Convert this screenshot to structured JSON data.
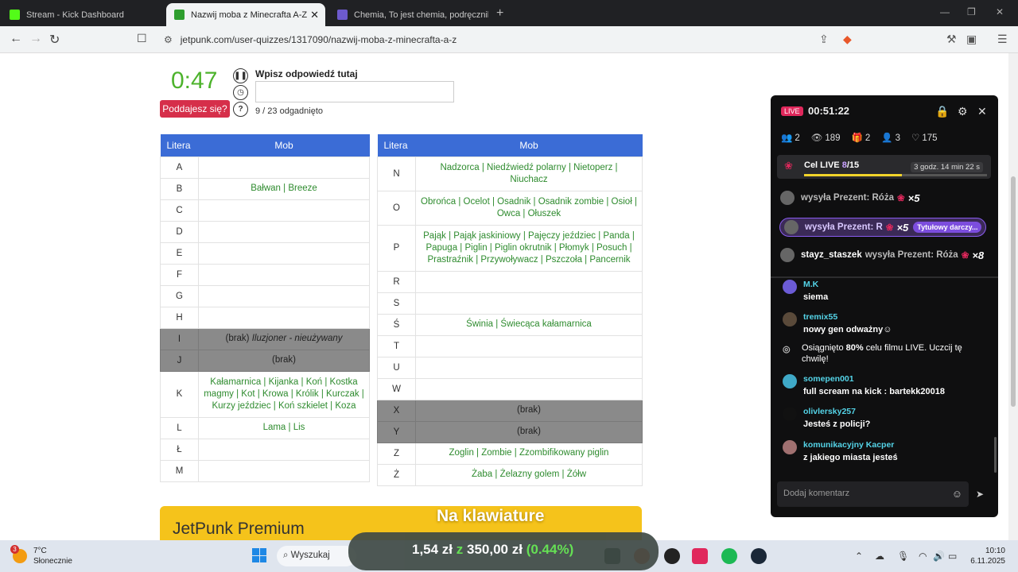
{
  "browser": {
    "tabs": [
      {
        "label": "Stream - Kick Dashboard",
        "active": false
      },
      {
        "label": "Nazwij moba z Minecrafta A-Z",
        "active": true
      },
      {
        "label": "Chemia, To jest chemia, podręcznik, l",
        "active": false
      }
    ],
    "url": "jetpunk.com/user-quizzes/1317090/nazwij-moba-z-minecrafta-a-z"
  },
  "quiz": {
    "timer": "0:47",
    "give_up": "Poddajesz się?",
    "answer_label": "Wpisz odpowiedź tutaj",
    "answer_value": "",
    "progress": "9 / 23 odgadnięto",
    "col_letter": "Litera",
    "col_mob": "Mob",
    "left_rows": [
      {
        "l": "A",
        "m": ""
      },
      {
        "l": "B",
        "m": "Bałwan | Breeze"
      },
      {
        "l": "C",
        "m": ""
      },
      {
        "l": "D",
        "m": ""
      },
      {
        "l": "E",
        "m": ""
      },
      {
        "l": "F",
        "m": ""
      },
      {
        "l": "G",
        "m": ""
      },
      {
        "l": "H",
        "m": ""
      },
      {
        "l": "I",
        "m": "(brak) Iluzjoner - nieużywany",
        "gray": true
      },
      {
        "l": "J",
        "m": "(brak)",
        "gray": true
      },
      {
        "l": "K",
        "m": "Kałamarnica | Kijanka | Koń | Kostka magmy | Kot | Krowa | Królik | Kurczak | Kurzy jeździec | Koń szkielet | Koza"
      },
      {
        "l": "L",
        "m": "Lama | Lis"
      },
      {
        "l": "Ł",
        "m": ""
      },
      {
        "l": "M",
        "m": ""
      }
    ],
    "right_rows": [
      {
        "l": "N",
        "m": "Nadzorca | Niedźwiedź polarny | Nietoperz | Niuchacz"
      },
      {
        "l": "O",
        "m": "Obrońca | Ocelot | Osadnik | Osadnik zombie | Osioł | Owca | Ołuszek"
      },
      {
        "l": "P",
        "m": "Pająk | Pająk jaskiniowy | Pajęczy jeździec | Panda | Papuga | Piglin | Piglin okrutnik | Płomyk | Posuch | Prastraźnik | Przywoływacz | Pszczoła | Pancernik"
      },
      {
        "l": "R",
        "m": ""
      },
      {
        "l": "S",
        "m": ""
      },
      {
        "l": "Ś",
        "m": "Świnia | Świecąca kałamarnica"
      },
      {
        "l": "T",
        "m": ""
      },
      {
        "l": "U",
        "m": ""
      },
      {
        "l": "W",
        "m": ""
      },
      {
        "l": "X",
        "m": "(brak)",
        "gray": true
      },
      {
        "l": "Y",
        "m": "(brak)",
        "gray": true
      },
      {
        "l": "Z",
        "m": "Zoglin | Zombie | Zzombifikowany piglin"
      },
      {
        "l": "Ż",
        "m": "Żaba | Żelazny golem | Żółw"
      }
    ],
    "premium_title": "JetPunk Premium",
    "overlay_text": "Na klawiature"
  },
  "live": {
    "badge": "LIVE",
    "time": "00:51:22",
    "stats": [
      {
        "icon": "users-icon",
        "glyph": "👥",
        "value": "2"
      },
      {
        "icon": "eye-icon",
        "glyph": "👁",
        "value": "189"
      },
      {
        "icon": "gift-icon",
        "glyph": "🎁",
        "value": "2"
      },
      {
        "icon": "follow-icon",
        "glyph": "👤",
        "value": "3"
      },
      {
        "icon": "heart-icon",
        "glyph": "♡",
        "value": "175"
      }
    ],
    "goal": {
      "label": "Cel LIVE",
      "current": "8",
      "total": "/15",
      "fraction": 0.533,
      "time_left": "3 godz. 14 min 22 s"
    },
    "gifts": [
      {
        "user": "",
        "text": "wysyła Prezent: Róża",
        "mult": "×5"
      },
      {
        "user": "",
        "text": "wysyła Prezent: R",
        "mult": "×5",
        "tag": "Tytułowy darczy..."
      },
      {
        "user": "stayz_staszek",
        "text": "wysyła Prezent: Róża",
        "mult": "×8"
      }
    ],
    "messages": [
      {
        "user": "M.K",
        "text": "siema",
        "color": "#6b5bd6"
      },
      {
        "user": "tremix55",
        "text": "nowy gen odważny☺",
        "color": "#5a4a3a"
      },
      {
        "user": "somepen001",
        "text": "full scream na kick : bartekk20018",
        "color": "#3fa9c7"
      },
      {
        "user": "olivlersky257",
        "text": "Jesteś z policji?",
        "color": "#111111"
      },
      {
        "user": "komunikacyjny Kacper",
        "text": "z jakiego miasta jesteś",
        "color": "#a07070"
      }
    ],
    "system": {
      "pre": "Osiągnięto",
      "pct": "80%",
      "post": "celu filmu LIVE. Uczcij tę chwilę!"
    },
    "comment_placeholder": "Dodaj komentarz"
  },
  "taskbar": {
    "weather_temp": "7°C",
    "weather_desc": "Słonecznie",
    "weather_badge": "3",
    "search": "Wyszukaj",
    "ticker_a": "1,54 zł",
    "ticker_z": "z",
    "ticker_b": "350,00 zł",
    "ticker_pct": "(0.44%)",
    "time": "10:10",
    "date": "6.11.2025"
  }
}
